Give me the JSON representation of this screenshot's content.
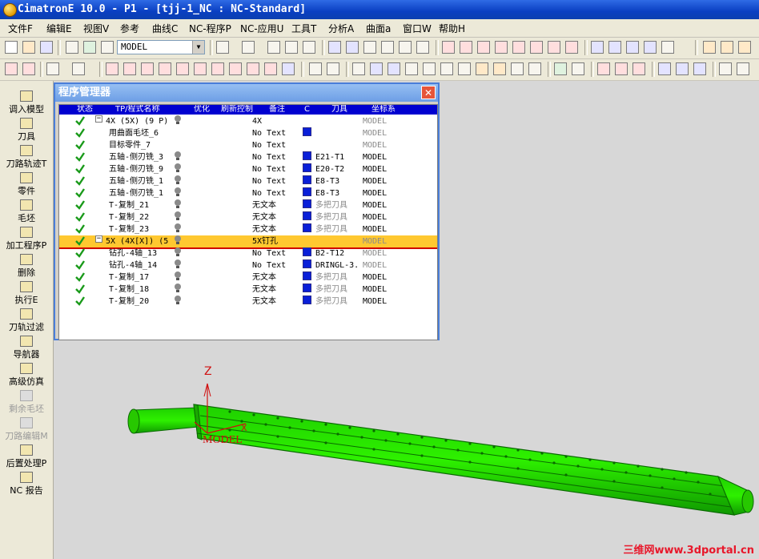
{
  "window": {
    "title": "CimatronE 10.0 - P1 - [tjj-1_NC : NC-Standard]"
  },
  "menu": [
    "文件F",
    "编辑E",
    "视图V",
    "参考",
    "曲线C",
    "NC-程序P",
    "NC-应用U",
    "工具T",
    "分析A",
    "曲面a",
    "窗口W",
    "帮助H"
  ],
  "toolbar": {
    "model_combo": "MODEL"
  },
  "sidebar": [
    "调入模型",
    "刀具",
    "刀路轨迹T",
    "零件",
    "毛坯",
    "加工程序P",
    "删除",
    "执行E",
    "刀轨过滤",
    "导航器",
    "高级仿真",
    "剩余毛坯",
    "刀路编辑M",
    "后置处理P",
    "NC 报告"
  ],
  "dialog": {
    "title": "程序管理器",
    "close": "✕",
    "columns": [
      "状态",
      "TP/程式名称",
      "优化",
      "刷新控制",
      "备注",
      "C",
      "刀具",
      "坐标系"
    ],
    "rows": [
      {
        "name": "4X (5X) (9 P)",
        "remark": "4X",
        "tool": "",
        "cs": "MODEL",
        "expand": "−",
        "bulb": true,
        "color": false,
        "indent": 0,
        "sel": false,
        "cs_gray": true
      },
      {
        "name": "用曲面毛坯_6",
        "remark": "No Text",
        "tool": "",
        "cs": "MODEL",
        "expand": "",
        "bulb": false,
        "color": true,
        "indent": 1,
        "sel": false,
        "cs_gray": true
      },
      {
        "name": "目标零件_7",
        "remark": "No Text",
        "tool": "",
        "cs": "MODEL",
        "expand": "",
        "bulb": false,
        "color": false,
        "indent": 1,
        "sel": false,
        "cs_gray": true
      },
      {
        "name": "五轴-侧刃铣_3",
        "remark": "No Text",
        "tool": "E21-T1",
        "cs": "MODEL",
        "expand": "",
        "bulb": true,
        "color": true,
        "indent": 1,
        "sel": false,
        "cs_gray": false
      },
      {
        "name": "五轴-侧刃铣_9",
        "remark": "No Text",
        "tool": "E20-T2",
        "cs": "MODEL",
        "expand": "",
        "bulb": true,
        "color": true,
        "indent": 1,
        "sel": false,
        "cs_gray": false
      },
      {
        "name": "五轴-侧刃铣_1",
        "remark": "No Text",
        "tool": "E8-T3",
        "cs": "MODEL",
        "expand": "",
        "bulb": true,
        "color": true,
        "indent": 1,
        "sel": false,
        "cs_gray": false
      },
      {
        "name": "五轴-侧刃铣_1",
        "remark": "No Text",
        "tool": "E8-T3",
        "cs": "MODEL",
        "expand": "",
        "bulb": true,
        "color": true,
        "indent": 1,
        "sel": false,
        "cs_gray": false
      },
      {
        "name": "T-复制_21",
        "remark": "无文本",
        "tool": "多把刀具",
        "cs": "MODEL",
        "expand": "",
        "bulb": true,
        "color": true,
        "indent": 1,
        "sel": false,
        "cs_gray": false
      },
      {
        "name": "T-复制_22",
        "remark": "无文本",
        "tool": "多把刀具",
        "cs": "MODEL",
        "expand": "",
        "bulb": true,
        "color": true,
        "indent": 1,
        "sel": false,
        "cs_gray": false
      },
      {
        "name": "T-复制_23",
        "remark": "无文本",
        "tool": "多把刀具",
        "cs": "MODEL",
        "expand": "",
        "bulb": true,
        "color": true,
        "indent": 1,
        "sel": false,
        "cs_gray": false
      },
      {
        "name": "5X (4X[X]) (5",
        "remark": "5X钉孔",
        "tool": "",
        "cs": "MODEL",
        "expand": "−",
        "bulb": true,
        "color": false,
        "indent": 0,
        "sel": true,
        "cs_gray": true
      },
      {
        "name": "钻孔-4轴_13",
        "remark": "No Text",
        "tool": "B2-T12",
        "cs": "MODEL",
        "expand": "",
        "bulb": true,
        "color": true,
        "indent": 1,
        "sel": false,
        "cs_gray": true
      },
      {
        "name": "钻孔-4轴_14",
        "remark": "No Text",
        "tool": "DRINGL-3.",
        "cs": "MODEL",
        "expand": "",
        "bulb": true,
        "color": true,
        "indent": 1,
        "sel": false,
        "cs_gray": true
      },
      {
        "name": "T-复制_17",
        "remark": "无文本",
        "tool": "多把刀具",
        "cs": "MODEL",
        "expand": "",
        "bulb": true,
        "color": true,
        "indent": 1,
        "sel": false,
        "cs_gray": false
      },
      {
        "name": "T-复制_18",
        "remark": "无文本",
        "tool": "多把刀具",
        "cs": "MODEL",
        "expand": "",
        "bulb": true,
        "color": true,
        "indent": 1,
        "sel": false,
        "cs_gray": false
      },
      {
        "name": "T-复制_20",
        "remark": "无文本",
        "tool": "多把刀具",
        "cs": "MODEL",
        "expand": "",
        "bulb": true,
        "color": true,
        "indent": 1,
        "sel": false,
        "cs_gray": false
      }
    ]
  },
  "viewport": {
    "axis_z": "Z",
    "axis_x": "X",
    "model_label": "MODEL",
    "part_color": "#22e000"
  },
  "watermark": "三维网www.3dportal.cn"
}
